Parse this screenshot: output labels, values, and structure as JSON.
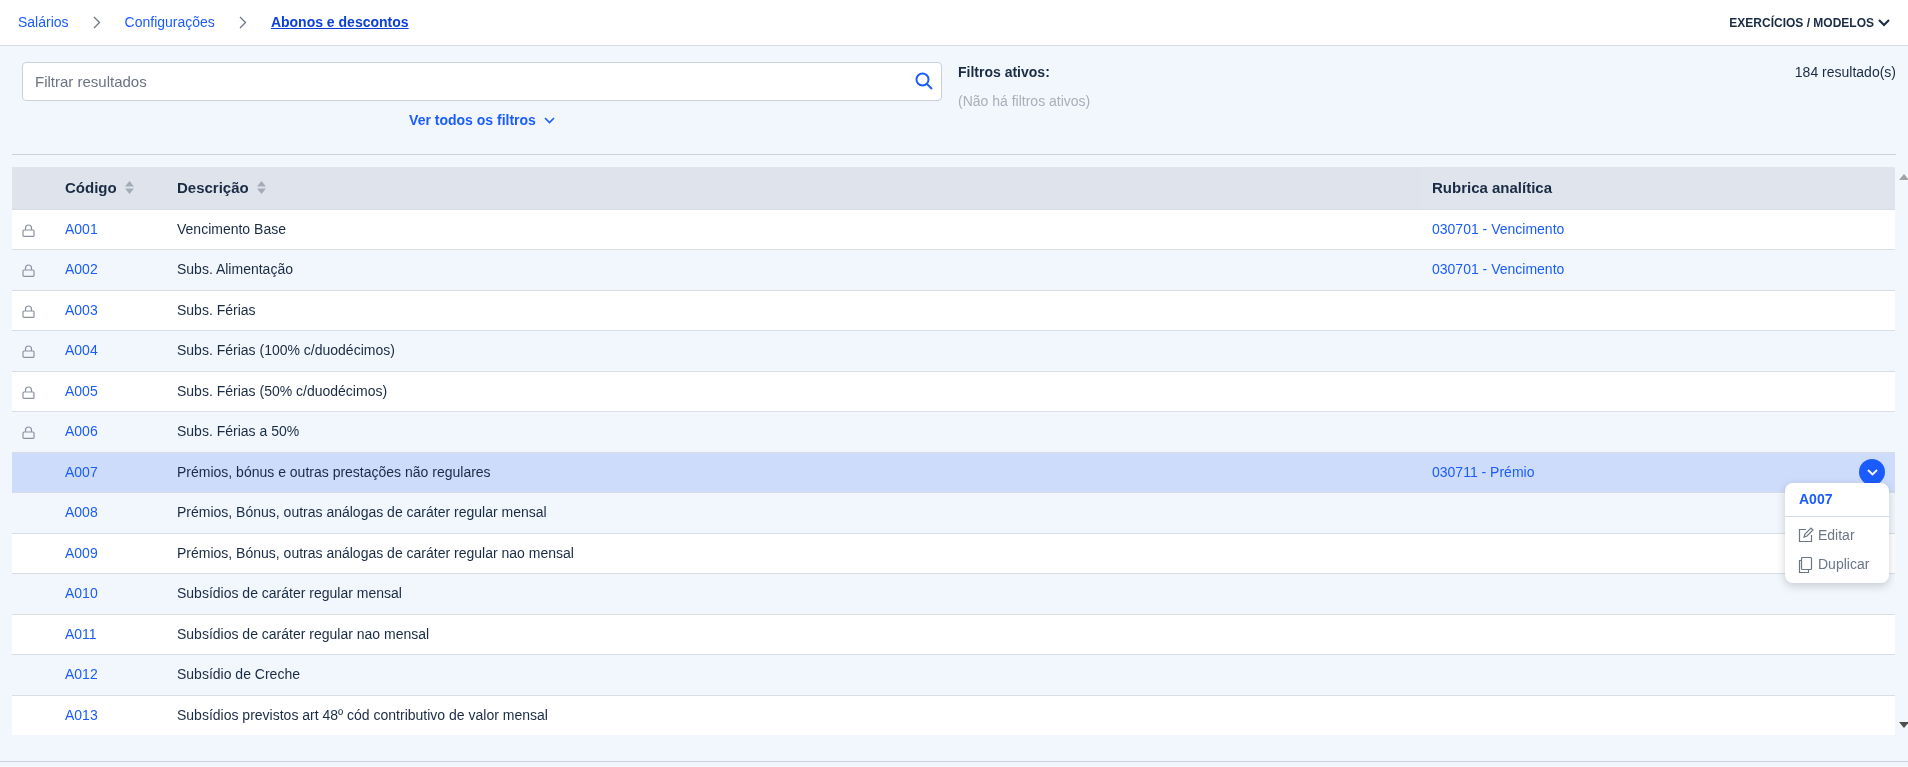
{
  "breadcrumbs": [
    {
      "label": "Salários",
      "current": false
    },
    {
      "label": "Configurações",
      "current": false
    },
    {
      "label": "Abonos e descontos",
      "current": true
    }
  ],
  "top_menu": {
    "label": "EXERCÍCIOS / MODELOS"
  },
  "search": {
    "placeholder": "Filtrar resultados"
  },
  "filters_toggle": {
    "label": "Ver todos os filtros"
  },
  "active_filters": {
    "title": "Filtros ativos:",
    "empty_text": "(Não há filtros ativos)"
  },
  "result_count": "184 resultado(s)",
  "table": {
    "columns": [
      {
        "label": "Código",
        "sortable": true
      },
      {
        "label": "Descrição",
        "sortable": true
      },
      {
        "label": "Rubrica analítica",
        "sortable": false
      }
    ],
    "rows": [
      {
        "code": "A001",
        "description": "Vencimento Base",
        "rubric": "030701 - Vencimento",
        "locked": true,
        "selected": false
      },
      {
        "code": "A002",
        "description": "Subs. Alimentação",
        "rubric": "030701 - Vencimento",
        "locked": true,
        "selected": false
      },
      {
        "code": "A003",
        "description": "Subs. Férias",
        "locked": true,
        "selected": false
      },
      {
        "code": "A004",
        "description": "Subs. Férias (100% c/duodécimos)",
        "locked": true,
        "selected": false
      },
      {
        "code": "A005",
        "description": "Subs. Férias (50% c/duodécimos)",
        "locked": true,
        "selected": false
      },
      {
        "code": "A006",
        "description": "Subs. Férias a 50%",
        "locked": true,
        "selected": false
      },
      {
        "code": "A007",
        "description": "Prémios, bónus e outras prestações não regulares",
        "rubric": "030711 - Prémio",
        "locked": false,
        "selected": true
      },
      {
        "code": "A008",
        "description": "Prémios, Bónus, outras análogas de caráter regular mensal",
        "locked": false,
        "selected": false
      },
      {
        "code": "A009",
        "description": "Prémios, Bónus, outras análogas de caráter regular nao mensal",
        "locked": false,
        "selected": false
      },
      {
        "code": "A010",
        "description": "Subsídios de caráter regular mensal",
        "locked": false,
        "selected": false
      },
      {
        "code": "A011",
        "description": "Subsídios de caráter regular nao mensal",
        "locked": false,
        "selected": false
      },
      {
        "code": "A012",
        "description": "Subsídio de Creche",
        "locked": false,
        "selected": false
      },
      {
        "code": "A013",
        "description": "Subsídios previstos art 48º cód contributivo de valor mensal",
        "locked": false,
        "selected": false
      }
    ]
  },
  "row_menu": {
    "title": "A007",
    "items": [
      {
        "kind": "edit",
        "label": "Editar"
      },
      {
        "kind": "duplicate",
        "label": "Duplicar"
      }
    ]
  }
}
